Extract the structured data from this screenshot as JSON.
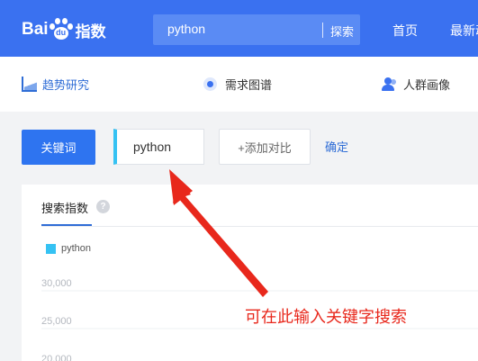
{
  "header": {
    "logo": {
      "text_bai": "Bai",
      "text_du": "du",
      "text_zhishu": "指数"
    },
    "search": {
      "value": "python",
      "button_label": "探索"
    },
    "nav": [
      {
        "label": "首页"
      },
      {
        "label": "最新动态"
      }
    ]
  },
  "subnav": {
    "items": [
      {
        "label": "趋势研究",
        "icon": "trend-chart-icon"
      },
      {
        "label": "需求图谱",
        "icon": "target-icon"
      },
      {
        "label": "人群画像",
        "icon": "user-group-icon"
      }
    ]
  },
  "keyword_row": {
    "keyword_button": "关键词",
    "keyword_value": "python",
    "add_compare": "+添加对比",
    "confirm": "确定"
  },
  "panel": {
    "tab_label": "搜索指数",
    "help_icon": "?",
    "legend": "python",
    "y_ticks": [
      "30,000",
      "25,000",
      "20,000"
    ]
  },
  "annotation": {
    "text": "可在此输入关键字搜索"
  },
  "colors": {
    "brand_blue": "#3a71f0",
    "series_cyan": "#35c2f3",
    "annotation_red": "#e8281c"
  }
}
